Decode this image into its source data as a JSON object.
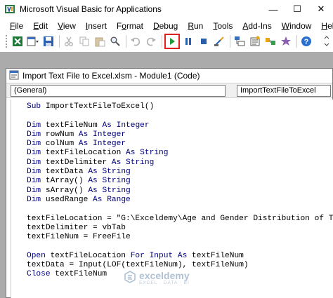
{
  "window": {
    "title": "Microsoft Visual Basic for Applications",
    "controls": {
      "minimize": "—",
      "maximize": "☐",
      "close": "✕"
    }
  },
  "menu": [
    {
      "label": "File",
      "key": "F",
      "rest": "ile"
    },
    {
      "label": "Edit",
      "key": "E",
      "rest": "dit"
    },
    {
      "label": "View",
      "key": "V",
      "rest": "iew"
    },
    {
      "label": "Insert",
      "key": "I",
      "rest": "nsert"
    },
    {
      "label": "Format",
      "pre": "F",
      "key": "o",
      "rest": "rmat"
    },
    {
      "label": "Debug",
      "key": "D",
      "rest": "ebug"
    },
    {
      "label": "Run",
      "key": "R",
      "rest": "un"
    },
    {
      "label": "Tools",
      "key": "T",
      "rest": "ools"
    },
    {
      "label": "Add-Ins",
      "key": "A",
      "rest": "dd-Ins"
    },
    {
      "label": "Window",
      "key": "W",
      "rest": "indow"
    },
    {
      "label": "Help",
      "key": "H",
      "rest": "elp"
    }
  ],
  "toolbar": {
    "icons": [
      "excel-icon",
      "insert-module-icon",
      "save-icon",
      "cut-icon",
      "copy-icon",
      "paste-icon",
      "find-icon",
      "undo-icon",
      "redo-icon",
      "run-icon",
      "break-icon",
      "reset-icon",
      "design-mode-icon",
      "project-explorer-icon",
      "properties-icon",
      "object-browser-icon",
      "toolbox-icon",
      "help-icon"
    ],
    "colors": {
      "run": "#1a9a3a",
      "highlight": "#e02020",
      "help": "#2a6fd0"
    }
  },
  "code_window": {
    "title": "Import Text File to Excel.xlsm - Module1 (Code)",
    "object_combo": "(General)",
    "procedure_combo": "ImportTextFileToExcel",
    "lines": [
      "Sub ImportTextFileToExcel()",
      "",
      "Dim textFileNum As Integer",
      "Dim rowNum As Integer",
      "Dim colNum As Integer",
      "Dim textFileLocation As String",
      "Dim textDelimiter As String",
      "Dim textData As String",
      "Dim tArray() As String",
      "Dim sArray() As String",
      "Dim usedRange As Range",
      "",
      "textFileLocation = \"G:\\Exceldemy\\Age and Gender Distribution of Te",
      "textDelimiter = vbTab",
      "textFileNum = FreeFile",
      "",
      "Open textFileLocation For Input As textFileNum",
      "textData = Input(LOF(textFileNum), textFileNum)",
      "Close textFileNum"
    ]
  },
  "watermark": {
    "name": "exceldemy",
    "tagline": "EXCEL · DATA · BI"
  }
}
